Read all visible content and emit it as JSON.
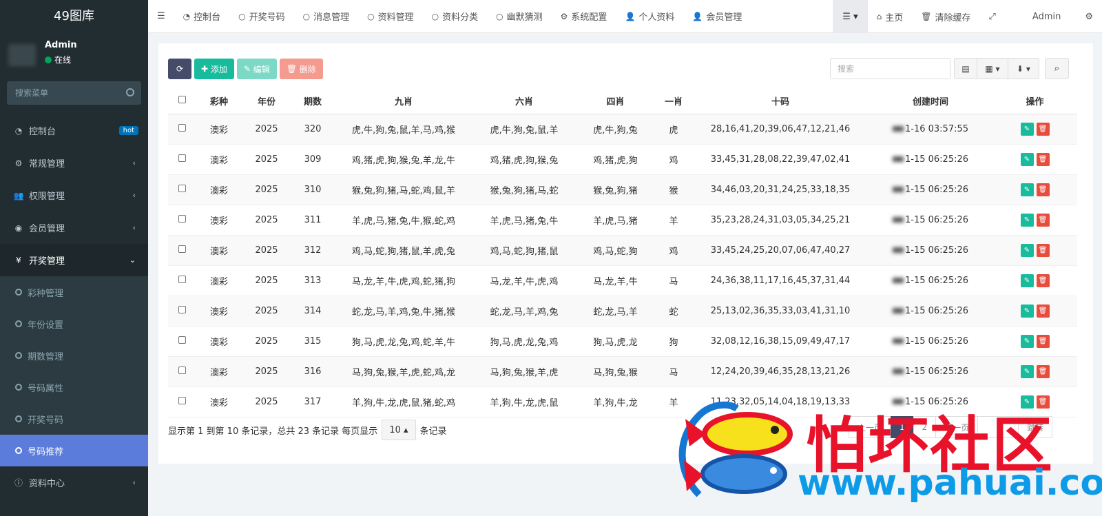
{
  "app": {
    "title": "49图库"
  },
  "user": {
    "name": "Admin",
    "status": "在线"
  },
  "sidebar": {
    "search_placeholder": "搜索菜单",
    "items": [
      {
        "label": "控制台",
        "badge": "hot"
      },
      {
        "label": "常规管理"
      },
      {
        "label": "权限管理"
      },
      {
        "label": "会员管理"
      },
      {
        "label": "开奖管理"
      },
      {
        "label": "资料中心"
      }
    ],
    "subitems": [
      "彩种管理",
      "年份设置",
      "期数管理",
      "号码属性",
      "开奖号码",
      "号码推荐"
    ]
  },
  "topnav": {
    "items": [
      "控制台",
      "开奖号码",
      "消息管理",
      "资料管理",
      "资料分类",
      "幽默猜测",
      "系统配置",
      "个人资料",
      "会员管理"
    ],
    "home": "主页",
    "clear_cache": "清除缓存",
    "admin": "Admin"
  },
  "toolbar": {
    "add": "添加",
    "edit": "编辑",
    "delete": "删除",
    "search_placeholder": "搜索"
  },
  "table": {
    "headers": [
      "彩种",
      "年份",
      "期数",
      "九肖",
      "六肖",
      "四肖",
      "一肖",
      "十码",
      "创建时间",
      "操作"
    ],
    "rows": [
      [
        "澳彩",
        "2025",
        "320",
        "虎,牛,狗,兔,鼠,羊,马,鸡,猴",
        "虎,牛,狗,兔,鼠,羊",
        "虎,牛,狗,兔",
        "虎",
        "28,16,41,20,39,06,47,12,21,46",
        "1-16 03:57:55"
      ],
      [
        "澳彩",
        "2025",
        "309",
        "鸡,猪,虎,狗,猴,兔,羊,龙,牛",
        "鸡,猪,虎,狗,猴,兔",
        "鸡,猪,虎,狗",
        "鸡",
        "33,45,31,28,08,22,39,47,02,41",
        "1-15 06:25:26"
      ],
      [
        "澳彩",
        "2025",
        "310",
        "猴,兔,狗,猪,马,蛇,鸡,鼠,羊",
        "猴,兔,狗,猪,马,蛇",
        "猴,兔,狗,猪",
        "猴",
        "34,46,03,20,31,24,25,33,18,35",
        "1-15 06:25:26"
      ],
      [
        "澳彩",
        "2025",
        "311",
        "羊,虎,马,猪,兔,牛,猴,蛇,鸡",
        "羊,虎,马,猪,兔,牛",
        "羊,虎,马,猪",
        "羊",
        "35,23,28,24,31,03,05,34,25,21",
        "1-15 06:25:26"
      ],
      [
        "澳彩",
        "2025",
        "312",
        "鸡,马,蛇,狗,猪,鼠,羊,虎,兔",
        "鸡,马,蛇,狗,猪,鼠",
        "鸡,马,蛇,狗",
        "鸡",
        "33,45,24,25,20,07,06,47,40,27",
        "1-15 06:25:26"
      ],
      [
        "澳彩",
        "2025",
        "313",
        "马,龙,羊,牛,虎,鸡,蛇,猪,狗",
        "马,龙,羊,牛,虎,鸡",
        "马,龙,羊,牛",
        "马",
        "24,36,38,11,17,16,45,37,31,44",
        "1-15 06:25:26"
      ],
      [
        "澳彩",
        "2025",
        "314",
        "蛇,龙,马,羊,鸡,兔,牛,猪,猴",
        "蛇,龙,马,羊,鸡,兔",
        "蛇,龙,马,羊",
        "蛇",
        "25,13,02,36,35,33,03,41,31,10",
        "1-15 06:25:26"
      ],
      [
        "澳彩",
        "2025",
        "315",
        "狗,马,虎,龙,兔,鸡,蛇,羊,牛",
        "狗,马,虎,龙,兔,鸡",
        "狗,马,虎,龙",
        "狗",
        "32,08,12,16,38,15,09,49,47,17",
        "1-15 06:25:26"
      ],
      [
        "澳彩",
        "2025",
        "316",
        "马,狗,兔,猴,羊,虎,蛇,鸡,龙",
        "马,狗,兔,猴,羊,虎",
        "马,狗,兔,猴",
        "马",
        "12,24,20,39,46,35,28,13,21,26",
        "1-15 06:25:26"
      ],
      [
        "澳彩",
        "2025",
        "317",
        "羊,狗,牛,龙,虎,鼠,猪,蛇,鸡",
        "羊,狗,牛,龙,虎,鼠",
        "羊,狗,牛,龙",
        "羊",
        "11,23,32,05,14,04,18,19,13,33",
        "1-15 06:25:26"
      ]
    ]
  },
  "pager": {
    "info": "显示第 1 到第 10 条记录，总共 23 条记录 每页显示",
    "page_size": "10",
    "suffix": "条记录",
    "prev": "上一页",
    "page1": "1",
    "page2": "2",
    "next": "下一页",
    "jump": "跳转"
  },
  "watermark": {
    "text": "怕坏社区",
    "url": "www.pahuai.com"
  }
}
